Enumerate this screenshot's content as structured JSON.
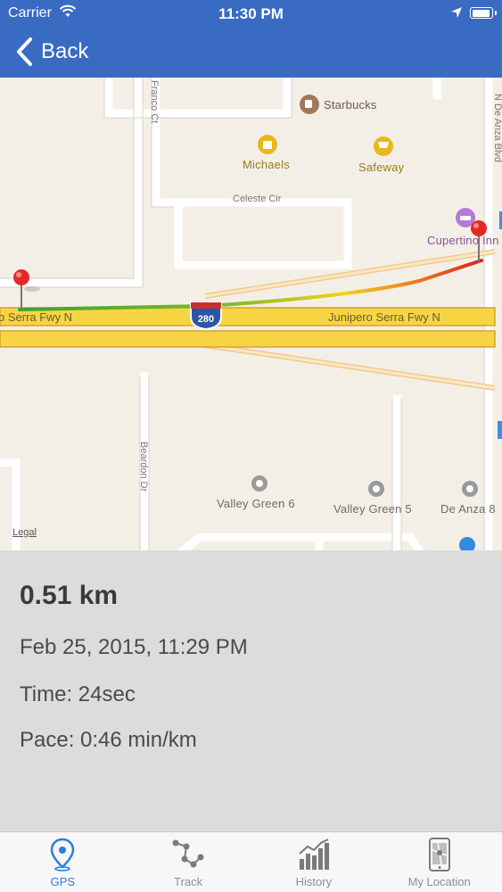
{
  "status": {
    "carrier": "Carrier",
    "time": "11:30 PM"
  },
  "nav": {
    "back_label": "Back"
  },
  "map": {
    "labels": {
      "franco": "Franco Ct",
      "starbucks": "Starbucks",
      "michaels": "Michaels",
      "safeway": "Safeway",
      "celeste": "Celeste Cir",
      "cupertino": "Cupertino Inn",
      "deanza_blvd": "N De Anza Blvd",
      "fwy_left": "o Serra Fwy N",
      "fwy_right": "Junipero Serra Fwy N",
      "shield": "280",
      "beardon": "Beardon Dr",
      "vg6": "Valley Green 6",
      "vg5": "Valley Green 5",
      "deanza8": "De Anza 8",
      "legal": "Legal"
    },
    "colors": {
      "route_start": "#3aa52c",
      "route_mid": "#f2d21a",
      "route_end": "#d8241f",
      "freeway": "#f7d542"
    }
  },
  "info": {
    "distance": "0.51 km",
    "date": "Feb 25, 2015, 11:29 PM",
    "time": "Time: 24sec",
    "pace": "Pace: 0:46 min/km"
  },
  "tabs": [
    {
      "label": "GPS",
      "icon": "location-pin-icon",
      "active": true
    },
    {
      "label": "Track",
      "icon": "track-nodes-icon",
      "active": false
    },
    {
      "label": "History",
      "icon": "bar-chart-icon",
      "active": false
    },
    {
      "label": "My Location",
      "icon": "phone-map-icon",
      "active": false
    }
  ],
  "colors": {
    "nav_blue": "#3a6bc3",
    "tab_active": "#2d7fd8"
  }
}
